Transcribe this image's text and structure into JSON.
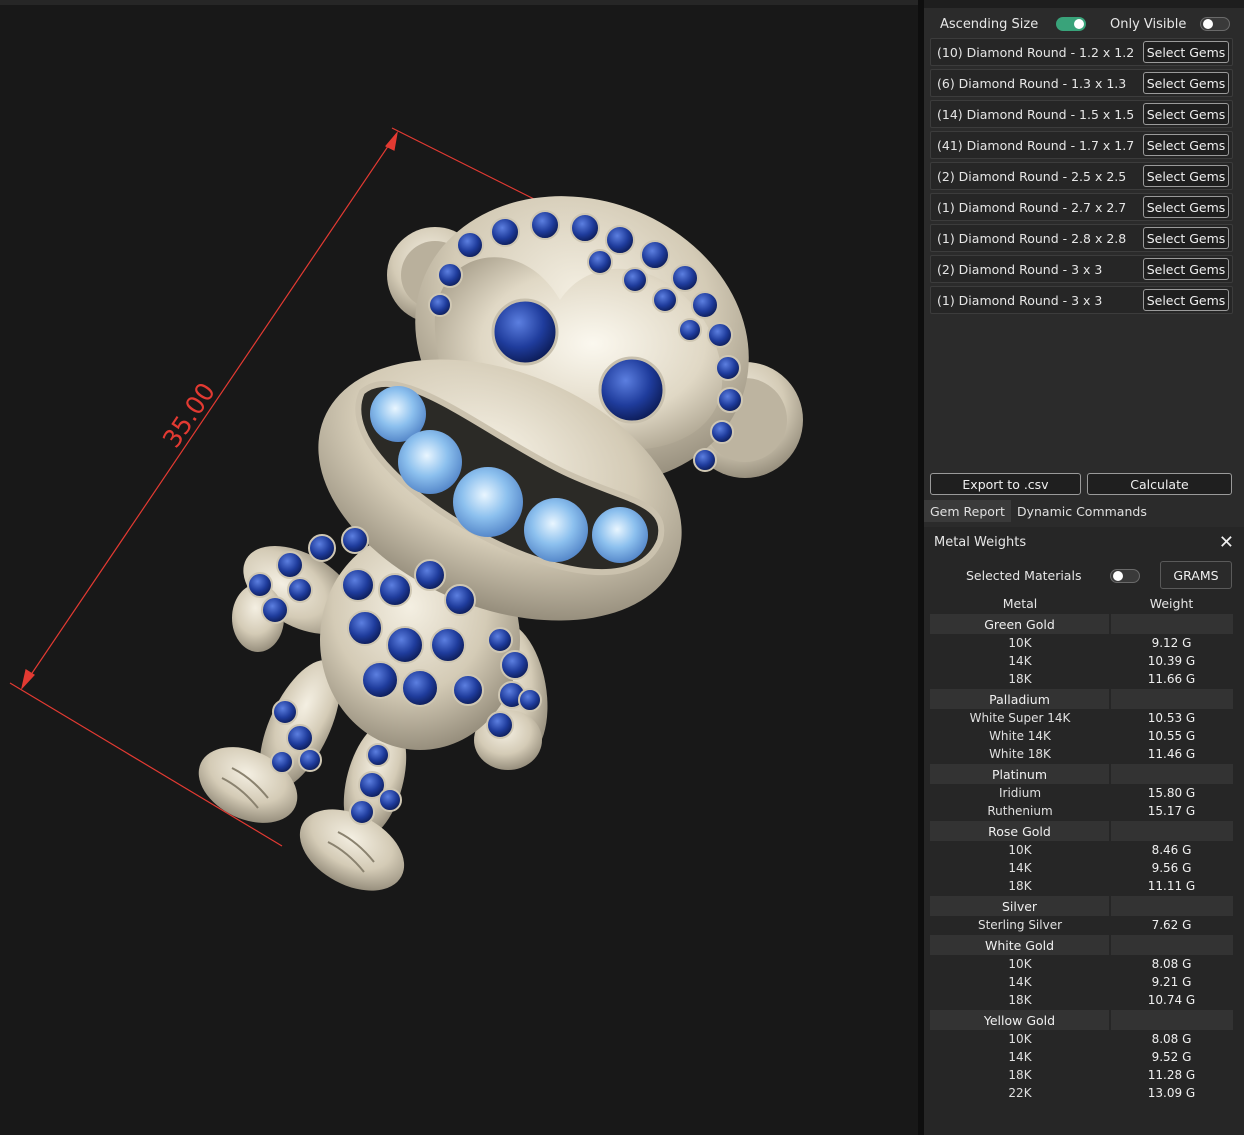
{
  "viewport": {
    "dimension_label": "35.00",
    "dimension_color": "#e33a32"
  },
  "gem_panel": {
    "ascending_size_label": "Ascending Size",
    "ascending_size_on": true,
    "only_visible_label": "Only Visible",
    "only_visible_on": false,
    "gems": [
      {
        "label": "(10) Diamond Round - 1.2 x 1.2",
        "button": "Select Gems"
      },
      {
        "label": "(6) Diamond Round - 1.3 x 1.3",
        "button": "Select Gems"
      },
      {
        "label": "(14) Diamond Round - 1.5 x 1.5",
        "button": "Select Gems"
      },
      {
        "label": "(41) Diamond Round - 1.7 x 1.7",
        "button": "Select Gems"
      },
      {
        "label": "(2) Diamond Round - 2.5 x 2.5",
        "button": "Select Gems"
      },
      {
        "label": "(1) Diamond Round - 2.7 x 2.7",
        "button": "Select Gems"
      },
      {
        "label": "(1) Diamond Round - 2.8 x 2.8",
        "button": "Select Gems"
      },
      {
        "label": "(2) Diamond Round - 3 x 3",
        "button": "Select Gems"
      },
      {
        "label": "(1) Diamond Round - 3 x 3",
        "button": "Select Gems"
      }
    ],
    "export_label": "Export to .csv",
    "calculate_label": "Calculate"
  },
  "tabs": [
    {
      "label": "Gem Report",
      "active": true
    },
    {
      "label": "Dynamic Commands",
      "active": false
    }
  ],
  "metal_weights": {
    "title": "Metal Weights",
    "close_icon": "close-icon",
    "selected_materials_label": "Selected Materials",
    "selected_materials_on": false,
    "unit_button": "GRAMS",
    "col_metal": "Metal",
    "col_weight": "Weight",
    "groups": [
      {
        "name": "Green Gold",
        "rows": [
          {
            "metal": "10K",
            "weight": "9.12 G"
          },
          {
            "metal": "14K",
            "weight": "10.39 G"
          },
          {
            "metal": "18K",
            "weight": "11.66 G"
          }
        ]
      },
      {
        "name": "Palladium",
        "rows": [
          {
            "metal": "White Super 14K",
            "weight": "10.53 G"
          },
          {
            "metal": "White 14K",
            "weight": "10.55 G"
          },
          {
            "metal": "White 18K",
            "weight": "11.46 G"
          }
        ]
      },
      {
        "name": "Platinum",
        "rows": [
          {
            "metal": "Iridium",
            "weight": "15.80 G"
          },
          {
            "metal": "Ruthenium",
            "weight": "15.17 G"
          }
        ]
      },
      {
        "name": "Rose Gold",
        "rows": [
          {
            "metal": "10K",
            "weight": "8.46 G"
          },
          {
            "metal": "14K",
            "weight": "9.56 G"
          },
          {
            "metal": "18K",
            "weight": "11.11 G"
          }
        ]
      },
      {
        "name": "Silver",
        "rows": [
          {
            "metal": "Sterling Silver",
            "weight": "7.62 G"
          }
        ]
      },
      {
        "name": "White Gold",
        "rows": [
          {
            "metal": "10K",
            "weight": "8.08 G"
          },
          {
            "metal": "14K",
            "weight": "9.21 G"
          },
          {
            "metal": "18K",
            "weight": "10.74 G"
          }
        ]
      },
      {
        "name": "Yellow Gold",
        "rows": [
          {
            "metal": "10K",
            "weight": "8.08 G"
          },
          {
            "metal": "14K",
            "weight": "9.52 G"
          },
          {
            "metal": "18K",
            "weight": "11.28 G"
          },
          {
            "metal": "22K",
            "weight": "13.09 G"
          }
        ]
      }
    ]
  }
}
